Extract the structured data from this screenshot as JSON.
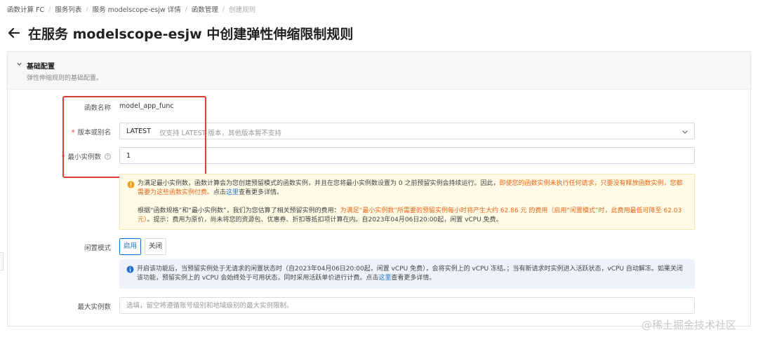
{
  "breadcrumb": [
    {
      "label": "函数计算 FC"
    },
    {
      "label": "服务列表"
    },
    {
      "label": "服务 modelscope-esjw 详情"
    },
    {
      "label": "函数管理"
    },
    {
      "label": "创建规则"
    }
  ],
  "page": {
    "title": "在服务 modelscope-esjw 中创建弹性伸缩限制规则"
  },
  "section": {
    "title": "基础配置",
    "description": "弹性伸缩规则的基础配置。"
  },
  "form": {
    "function_name": {
      "label": "函数名称",
      "value": "model_app_func"
    },
    "version_alias": {
      "label": "版本或别名",
      "required_mark": "*",
      "value": "LATEST",
      "hint": "仅支持 LATEST 版本，其他版本暂不支持"
    },
    "min_instances": {
      "label": "最小实例数",
      "required_mark": "*",
      "value": "1",
      "help_icon": "question-circle-icon"
    },
    "warning": {
      "icon": "warning-circle-icon",
      "p1_text": "为满足最小实例数，函数计算会为您创建预留模式的函数实例，并且在您将最小实例数设置为 0 之前预留实例会持续运行。因此，",
      "p1_orange": "即使您的函数实例未执行任何请求，只要没有释放函数实例，您都需要为这些函数实例付费。",
      "p1_prefix_link": "点击",
      "p1_link": "这里",
      "p1_suffix": "查看更多详情。",
      "p2_text": "根据“函数规格”和“最小实例数”，我们为您估算了相关预留实例的费用：",
      "p2_orange": "为满足“最小实例数”所需要的预留实例每小时将产生大约 62.86 元 的费用（启用“闲置模式”时，此费用最低可降至 62.03 元）",
      "p2_suffix": "。提示：费用为原价，尚未将您的资源包、优惠券、折扣等抵扣项计算在内。自2023年04月06日20:00起，闲置 vCPU 免费。"
    },
    "idle_mode": {
      "label": "闲置模式",
      "enable_label": "启用",
      "disable_label": "关闭",
      "selected": "启用"
    },
    "info": {
      "icon": "info-circle-icon",
      "text": "开启该功能后，当预留实例处于无请求的闲置状态时（自2023年04月06日20:00起，闲置 vCPU 免费），会将实例上的 vCPU 冻结。；当有新请求时实例进入活跃状态，vCPU 自动解冻。如果关闭该功能，预留实例上的 vCPU 会始终处于可用状态，同时采用活跃单价进行计费。点击",
      "link": "这里",
      "suffix": "查看更多详情。"
    },
    "max_instances": {
      "label": "最大实例数",
      "placeholder": "选填，留空将遵循账号级别和地域级别的最大实例限制。"
    }
  },
  "watermark": "@稀土掘金技术社区",
  "colors": {
    "accent": "#1a6fd1",
    "warning_text": "#e8671b",
    "highlight_border": "#e03b35",
    "required": "#e23b2e"
  }
}
